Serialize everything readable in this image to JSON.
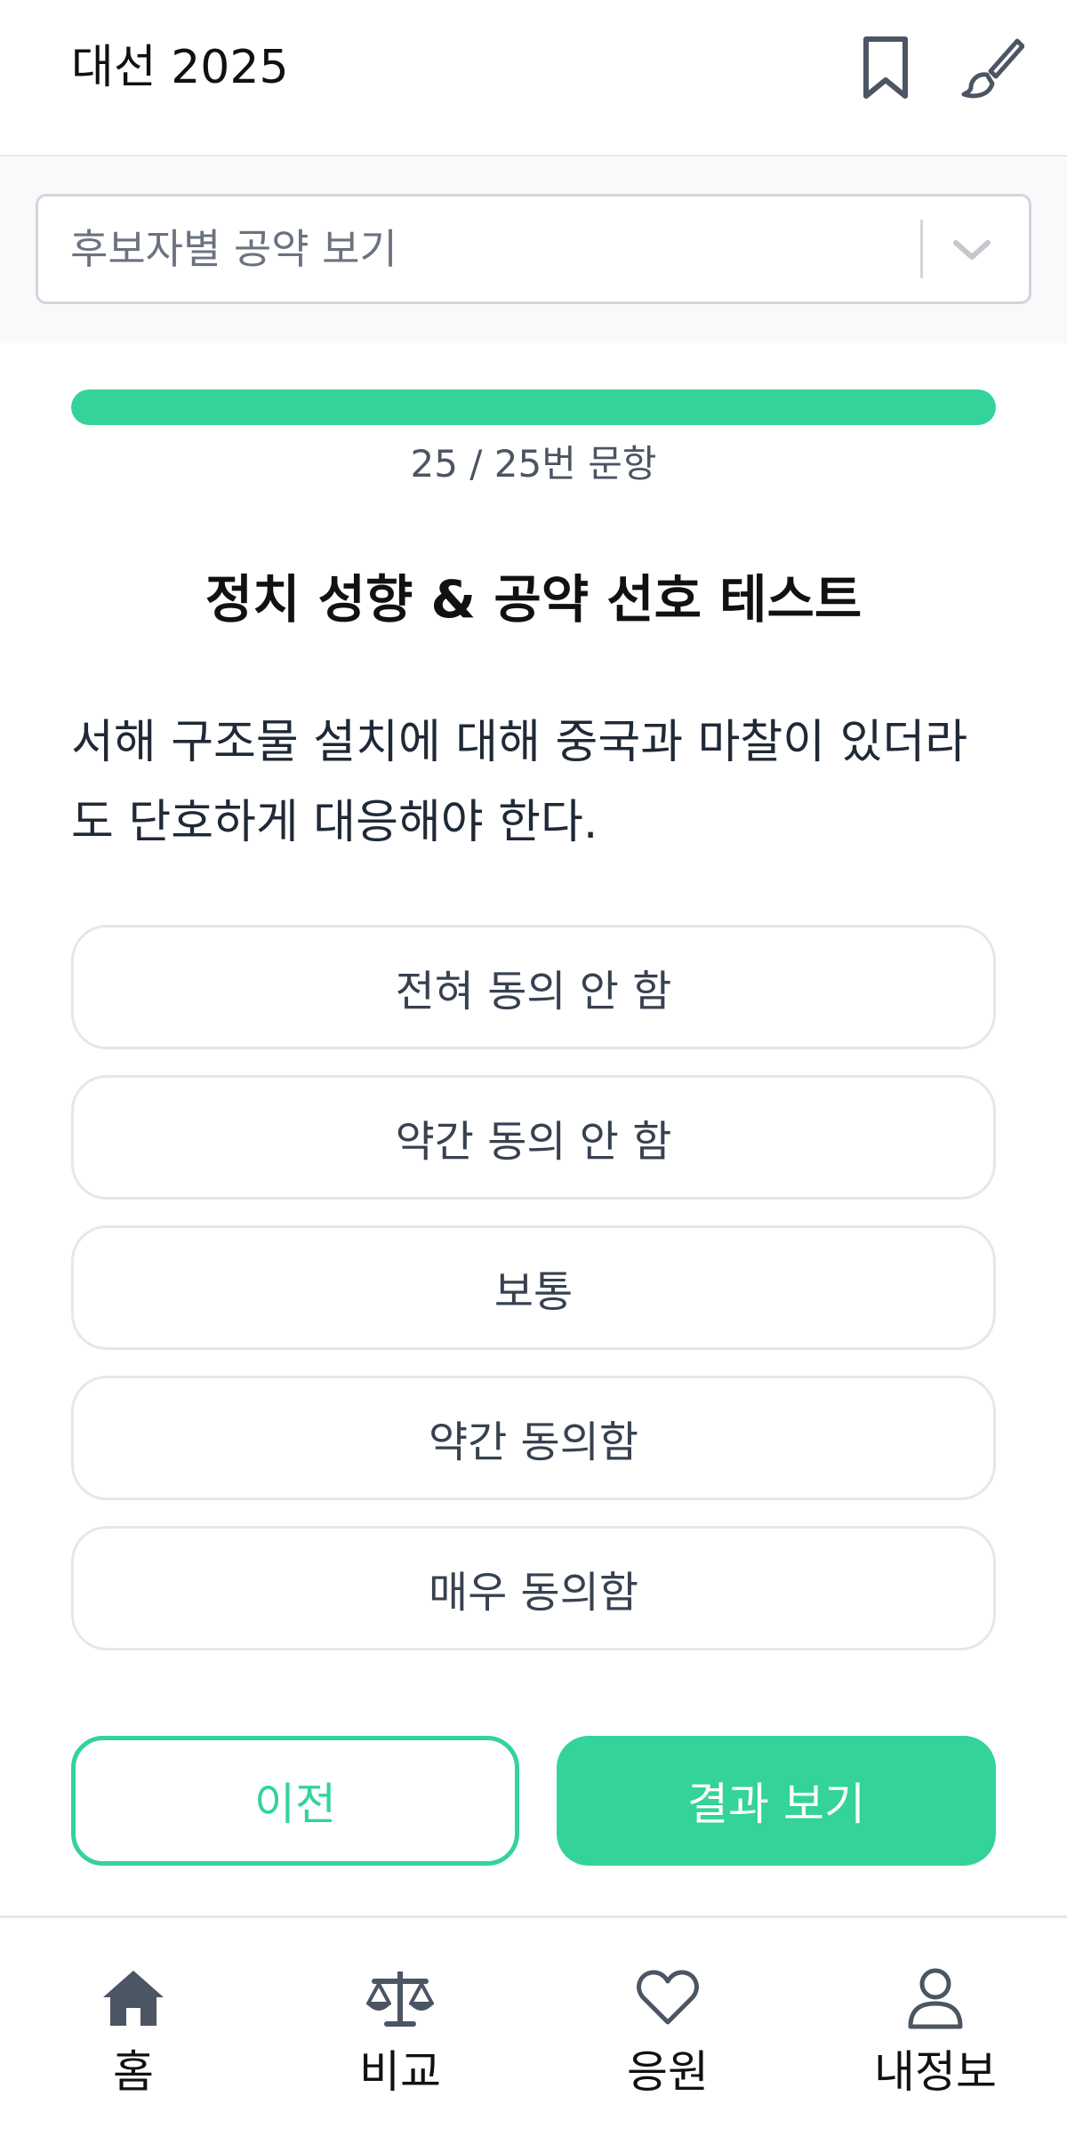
{
  "app_bar": {
    "title": "대선 2025",
    "bookmark_icon": "bookmark-icon",
    "theme_icon": "paintbrush-icon"
  },
  "filter": {
    "select_label": "후보자별 공약 보기",
    "chevron_icon": "chevron-down-icon"
  },
  "progress": {
    "current": 25,
    "total": 25,
    "fraction": 1.0,
    "text": "25 / 25번 문항",
    "color": "#34d399"
  },
  "test": {
    "title": "정치 성향 & 공약 선호 테스트",
    "question": "서해 구조물 설치에 대해 중국과 마찰이 있더라도 단호하게 대응해야 한다."
  },
  "options": [
    "전혀 동의 안 함",
    "약간 동의 안 함",
    "보통",
    "약간 동의함",
    "매우 동의함"
  ],
  "actions": {
    "prev_label": "이전",
    "result_label": "결과 보기",
    "accent": "#34d399"
  },
  "bottom_nav": [
    {
      "label": "홈",
      "icon": "home-icon"
    },
    {
      "label": "비교",
      "icon": "scale-icon"
    },
    {
      "label": "응원",
      "icon": "heart-icon"
    },
    {
      "label": "내정보",
      "icon": "user-icon"
    }
  ]
}
